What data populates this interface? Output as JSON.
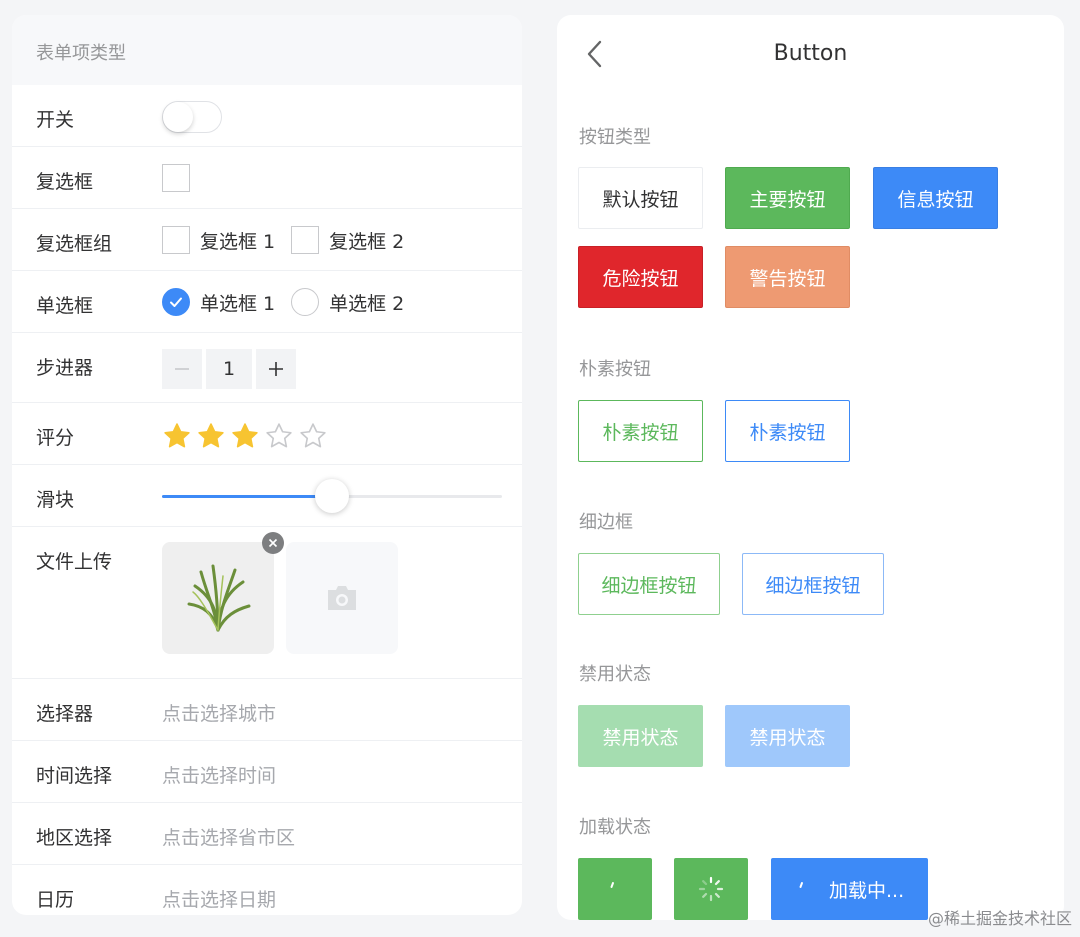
{
  "left": {
    "header": "表单项类型",
    "switch_label": "开关",
    "checkbox_label": "复选框",
    "checkbox_group_label": "复选框组",
    "checkbox_group_items": [
      "复选框 1",
      "复选框 2"
    ],
    "radio_label": "单选框",
    "radio_items": [
      "单选框 1",
      "单选框 2"
    ],
    "radio_selected": "单选框 1",
    "stepper_label": "步进器",
    "stepper_value": "1",
    "rate_label": "评分",
    "rate_value": 3,
    "rate_max": 5,
    "slider_label": "滑块",
    "slider_value_percent": 50,
    "upload_label": "文件上传",
    "picker_label": "选择器",
    "picker_placeholder": "点击选择城市",
    "time_label": "时间选择",
    "time_placeholder": "点击选择时间",
    "area_label": "地区选择",
    "area_placeholder": "点击选择省市区",
    "calendar_label": "日历",
    "calendar_placeholder": "点击选择日期"
  },
  "right": {
    "title": "Button",
    "sections": {
      "types": "按钮类型",
      "plain": "朴素按钮",
      "hairline": "细边框",
      "disabled": "禁用状态",
      "loading": "加载状态"
    },
    "buttons": {
      "default": "默认按钮",
      "primary": "主要按钮",
      "info": "信息按钮",
      "danger": "危险按钮",
      "warning": "警告按钮",
      "plain": "朴素按钮",
      "hairline": "细边框按钮",
      "disabled": "禁用状态",
      "loading_text": "加载中..."
    }
  },
  "colors": {
    "primary_green": "#5cb85c",
    "info_blue": "#3d8af7",
    "danger_red": "#e0262c",
    "warning_orange": "#ee9a72",
    "star_yellow": "#f7c431"
  },
  "watermark": "@稀土掘金技术社区"
}
